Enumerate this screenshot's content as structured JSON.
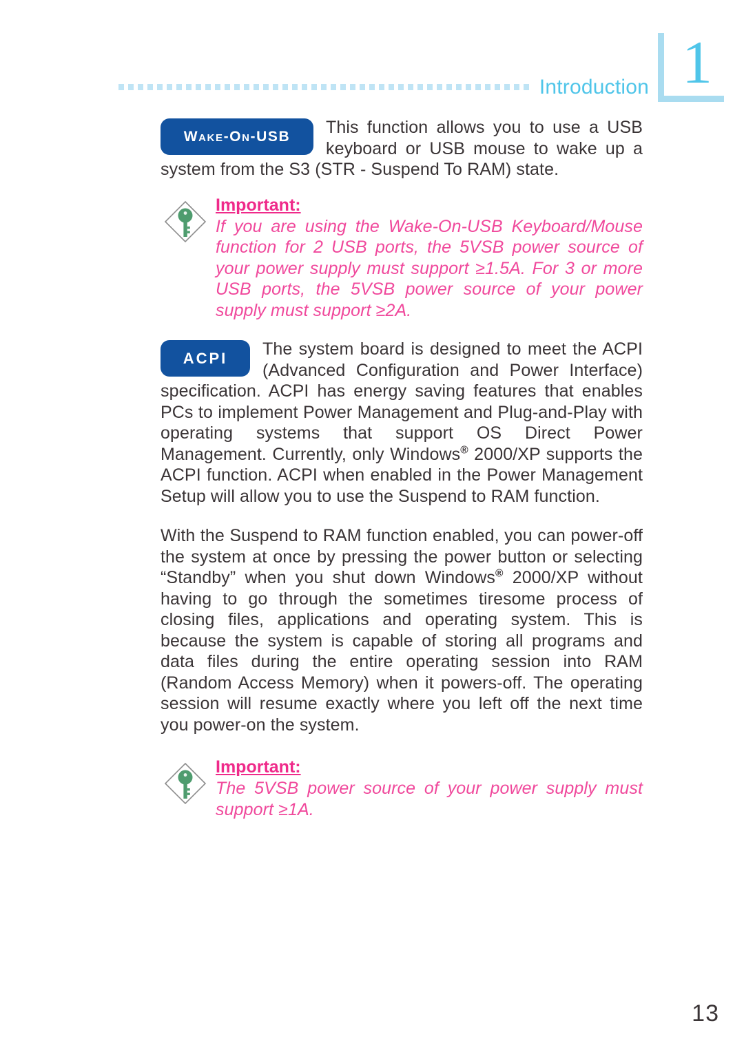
{
  "header": {
    "chapter_number": "1",
    "section_title": "Introduction"
  },
  "sections": {
    "wake_on_usb": {
      "badge_label": "Wake-On-USB",
      "paragraph": "This function allows you to use a USB keyboard or USB mouse to wake up a system from the S3 (STR - Suspend To RAM) state."
    },
    "important_note_1": {
      "icon": "key-icon",
      "title": "Important:",
      "body": "If you are using the Wake-On-USB Keyboard/Mouse function for 2 USB ports, the 5VSB power source of your power supply must support ≥1.5A. For 3 or more USB ports, the 5VSB power source of your power supply must support ≥2A."
    },
    "acpi": {
      "badge_label": "ACPI",
      "paragraph_part1": "The system board is designed to meet the ACPI (Advanced Configuration and Power Interface) specification. ACPI has energy saving features that enables PCs to implement Power Management and Plug-and-Play with operating systems that support OS Direct Power Management. Currently, only Windows",
      "registered_mark": "®",
      "paragraph_part2": " 2000/XP supports the ACPI function. ACPI when enabled in the Power Management Setup will allow you to use the Suspend to RAM function."
    },
    "suspend_to_ram": {
      "paragraph_part1": "With the Suspend to RAM function enabled, you can power-off the system at once by pressing the power button or selecting “Standby” when you shut down Windows",
      "registered_mark": "®",
      "paragraph_part2": " 2000/XP without having to go through the sometimes tiresome process of closing files, applications and operating system. This is because the system is capable of storing all programs and data files during the entire operating session into RAM (Random Access Memory) when it powers-off. The operating session will resume exactly where you left off the next time you power-on the system."
    },
    "important_note_2": {
      "icon": "key-icon",
      "title": "Important:",
      "body": "The 5VSB power source of your power supply must support ≥1A."
    }
  },
  "footer": {
    "page_number": "13"
  },
  "colors": {
    "badge_blue": "#12529f",
    "title_blue": "#4fc5e9",
    "rule_blue": "#bfe4f5",
    "note_pink": "#f0499c",
    "note_title_pink": "#ef2a8a",
    "key_green": "#4e9c6e",
    "body_text": "#3a3436"
  }
}
